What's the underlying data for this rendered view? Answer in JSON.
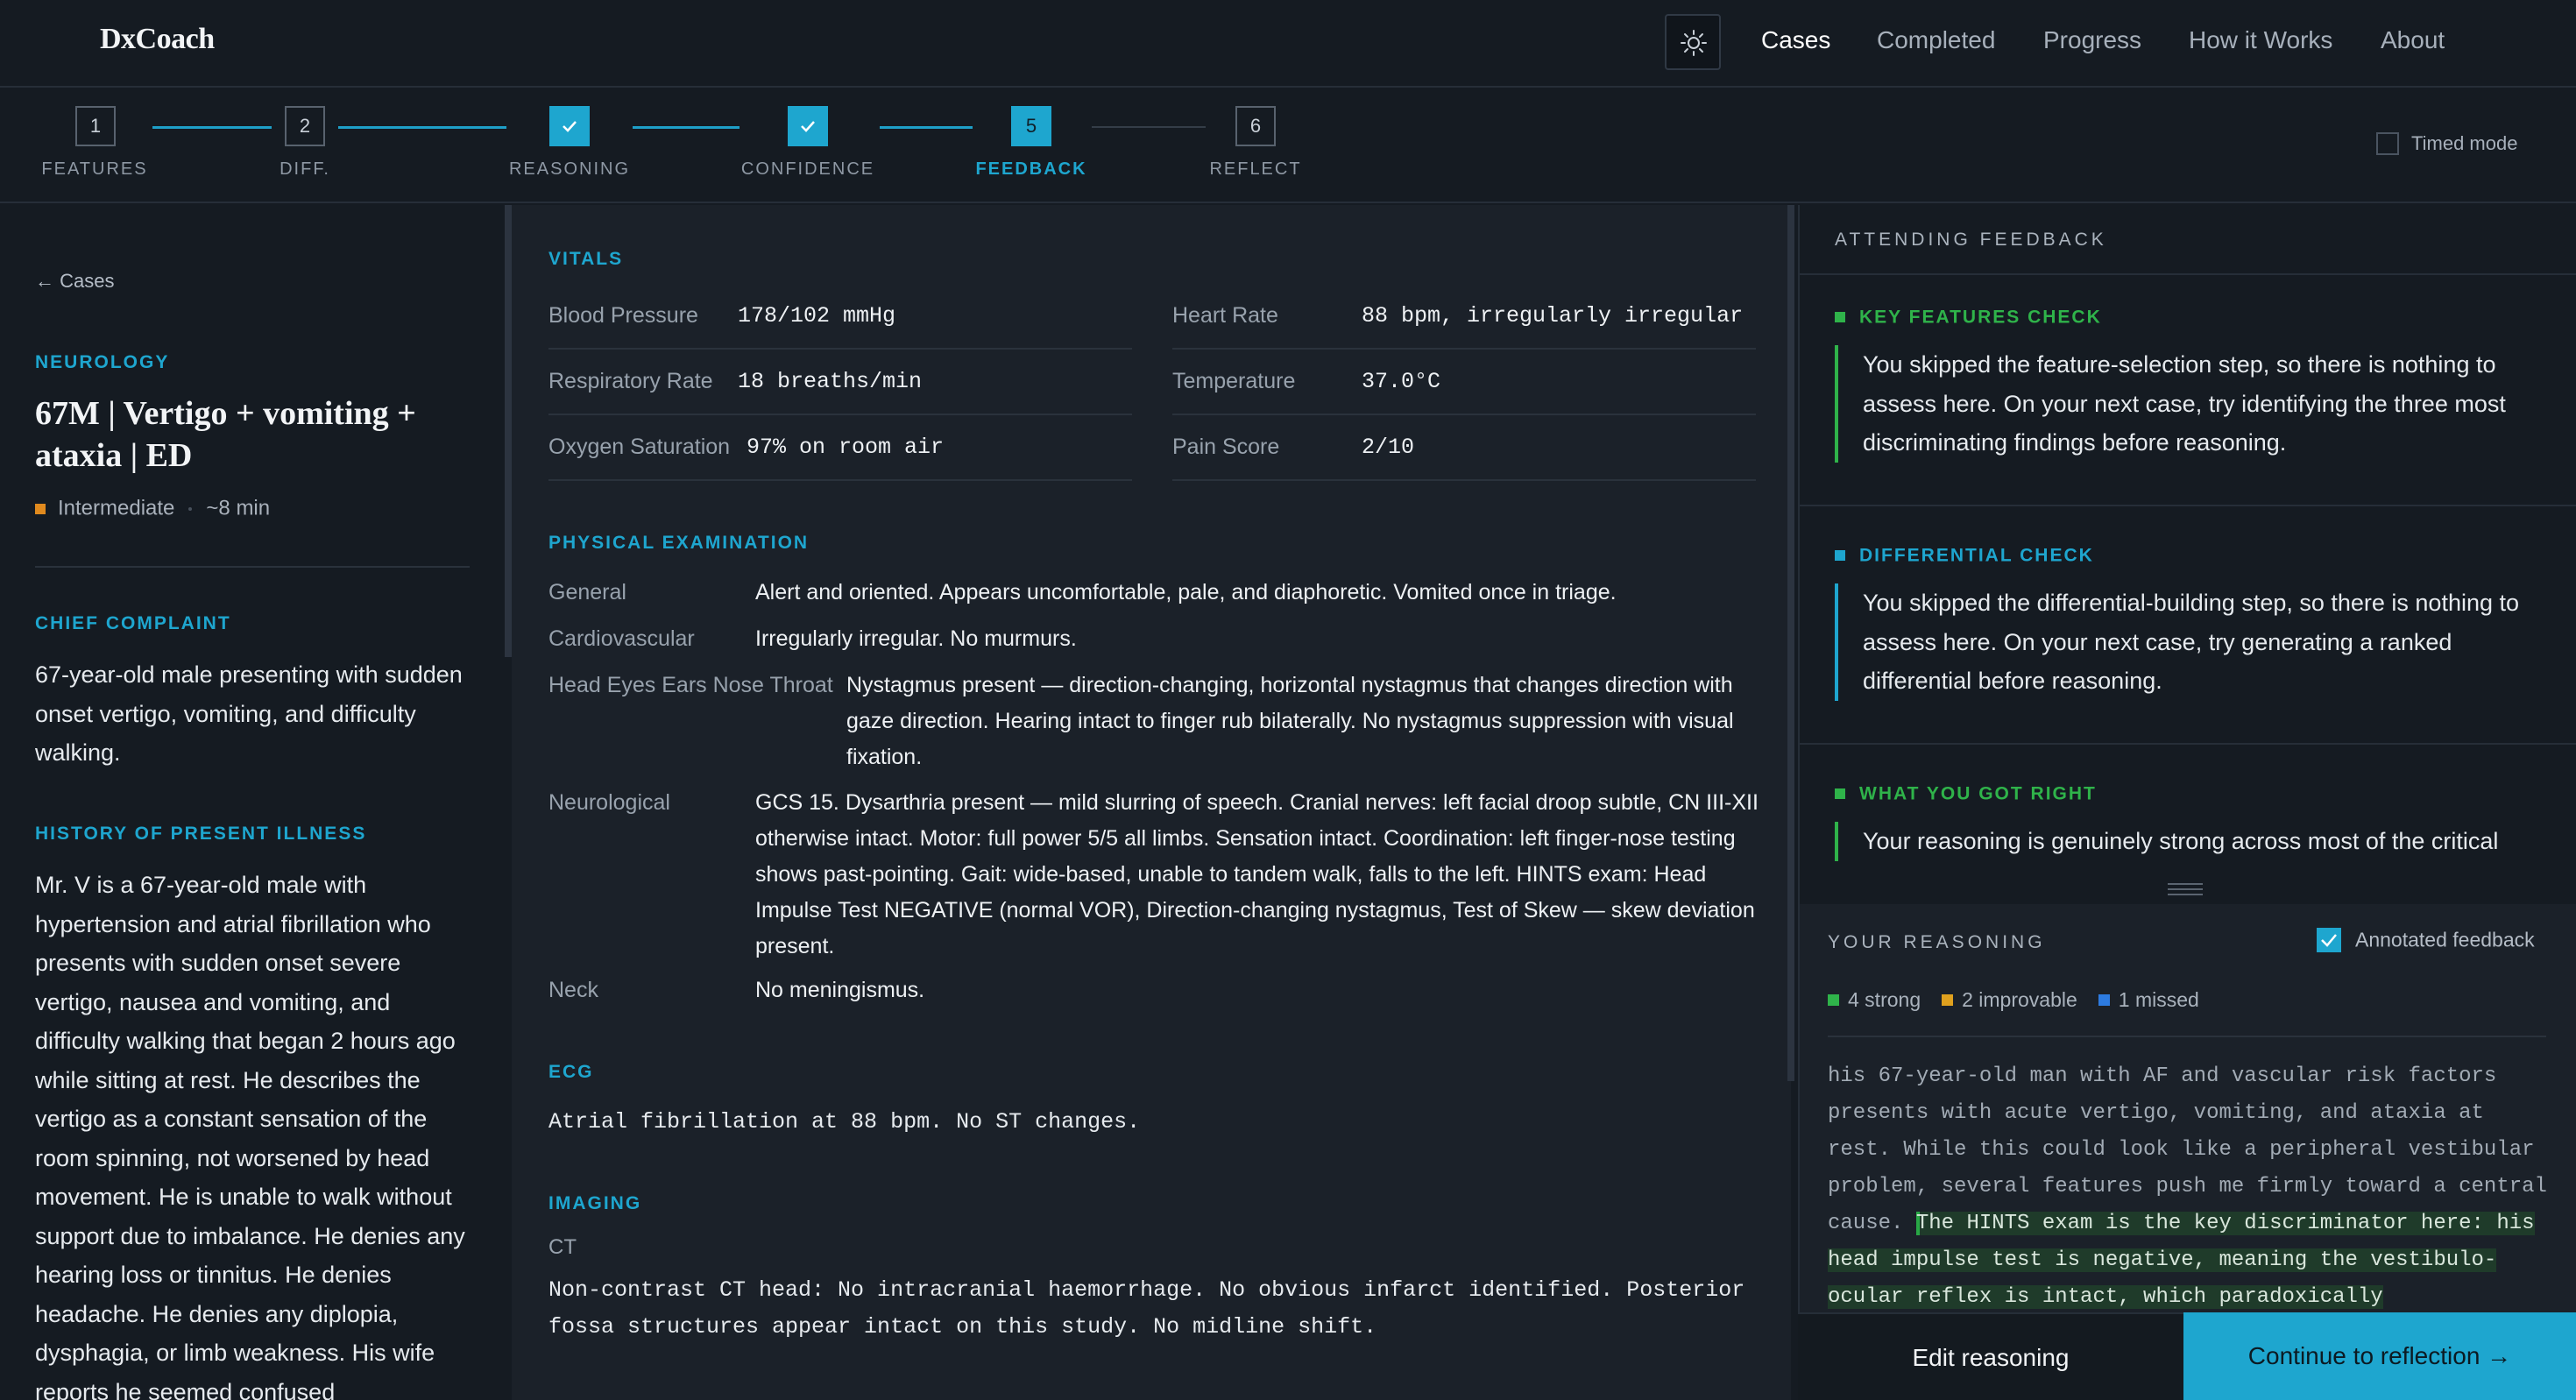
{
  "app": {
    "brand": "DxCoach"
  },
  "nav": {
    "items": [
      {
        "label": "Cases"
      },
      {
        "label": "Completed"
      },
      {
        "label": "Progress"
      },
      {
        "label": "How it Works"
      },
      {
        "label": "About"
      }
    ],
    "active": "Cases"
  },
  "stepper": {
    "steps": [
      {
        "num": "1",
        "label": "FEATURES",
        "state": "pending"
      },
      {
        "num": "2",
        "label": "DIFF.",
        "state": "pending"
      },
      {
        "num": "",
        "label": "REASONING",
        "state": "done"
      },
      {
        "num": "",
        "label": "CONFIDENCE",
        "state": "done"
      },
      {
        "num": "5",
        "label": "FEEDBACK",
        "state": "current"
      },
      {
        "num": "6",
        "label": "REFLECT",
        "state": "pending"
      }
    ],
    "timed_mode_label": "Timed mode"
  },
  "case": {
    "back": "← Cases",
    "specialty": "NEUROLOGY",
    "title": "67M | Vertigo + vomiting + ataxia | ED",
    "difficulty": "Intermediate",
    "duration": "~8 min",
    "chief_complaint_head": "CHIEF COMPLAINT",
    "chief_complaint": "67-year-old male presenting with sudden onset vertigo, vomiting, and difficulty walking.",
    "hpi_head": "HISTORY OF PRESENT ILLNESS",
    "hpi": "Mr. V is a 67-year-old male with hypertension and atrial fibrillation who presents with sudden onset severe vertigo, nausea and vomiting, and difficulty walking that began 2 hours ago while sitting at rest. He describes the vertigo as a constant sensation of the room spinning, not worsened by head movement. He is unable to walk without support due to imbalance. He denies any hearing loss or tinnitus. He denies headache. He denies any diplopia, dysphagia, or limb weakness. His wife reports he seemed confused"
  },
  "vitals": {
    "head": "VITALS",
    "items": [
      {
        "label": "Blood Pressure",
        "value": "178/102 mmHg"
      },
      {
        "label": "Heart Rate",
        "value": "88 bpm, irregularly irregular"
      },
      {
        "label": "Respiratory Rate",
        "value": "18 breaths/min"
      },
      {
        "label": "Temperature",
        "value": "37.0°C"
      },
      {
        "label": "Oxygen Saturation",
        "value": "97% on room air"
      },
      {
        "label": "Pain Score",
        "value": "2/10"
      }
    ]
  },
  "exam": {
    "head": "PHYSICAL EXAMINATION",
    "rows": [
      {
        "label": "General",
        "value": "Alert and oriented. Appears uncomfortable, pale, and diaphoretic. Vomited once in triage."
      },
      {
        "label": "Cardiovascular",
        "value": "Irregularly irregular. No murmurs."
      },
      {
        "label": "Head Eyes Ears Nose Throat",
        "value": "Nystagmus present — direction-changing, horizontal nystagmus that changes direction with gaze direction. Hearing intact to finger rub bilaterally. No nystagmus suppression with visual fixation."
      },
      {
        "label": "Neurological",
        "value": "GCS 15. Dysarthria present — mild slurring of speech. Cranial nerves: left facial droop subtle, CN III-XII otherwise intact. Motor: full power 5/5 all limbs. Sensation intact. Coordination: left finger-nose testing shows past-pointing. Gait: wide-based, unable to tandem walk, falls to the left. HINTS exam: Head Impulse Test NEGATIVE (normal VOR), Direction-changing nystagmus, Test of Skew — skew deviation present."
      },
      {
        "label": "Neck",
        "value": "No meningismus."
      }
    ]
  },
  "ecg": {
    "head": "ECG",
    "text": "Atrial fibrillation at 88 bpm. No ST changes."
  },
  "imaging": {
    "head": "IMAGING",
    "modality": "CT",
    "text": "Non-contrast CT head: No intracranial haemorrhage. No obvious infarct identified. Posterior fossa structures appear intact on this study. No midline shift."
  },
  "feedback": {
    "head": "ATTENDING FEEDBACK",
    "blocks": [
      {
        "title": "KEY FEATURES CHECK",
        "color": "#2fb34a",
        "body": "You skipped the feature-selection step, so there is nothing to assess here. On your next case, try identifying the three most discriminating findings before reasoning."
      },
      {
        "title": "DIFFERENTIAL CHECK",
        "color": "#1ea6cf",
        "body": "You skipped the differential-building step, so there is nothing to assess here. On your next case, try generating a ranked differential before reasoning."
      },
      {
        "title": "WHAT YOU GOT RIGHT",
        "color": "#2fb34a",
        "body": "Your reasoning is genuinely strong across most of the critical"
      }
    ]
  },
  "reasoning": {
    "head": "YOUR REASONING",
    "annotated_label": "Annotated feedback",
    "legend": [
      {
        "label": "4 strong",
        "color": "#2fb34a"
      },
      {
        "label": "2 improvable",
        "color": "#e0a11e"
      },
      {
        "label": "1 missed",
        "color": "#2d7be0"
      }
    ],
    "plain_text": "his 67-year-old man with AF and vascular risk factors presents with acute vertigo, vomiting, and ataxia at rest. While this could look like a peripheral vestibular problem, several features push me firmly toward a central cause. ",
    "highlight_text": "The HINTS exam is the key discriminator here: his head impulse test is negative, meaning the vestibulo-ocular reflex is intact, which paradoxically"
  },
  "actions": {
    "edit": "Edit reasoning",
    "continue": "Continue to reflection →"
  }
}
